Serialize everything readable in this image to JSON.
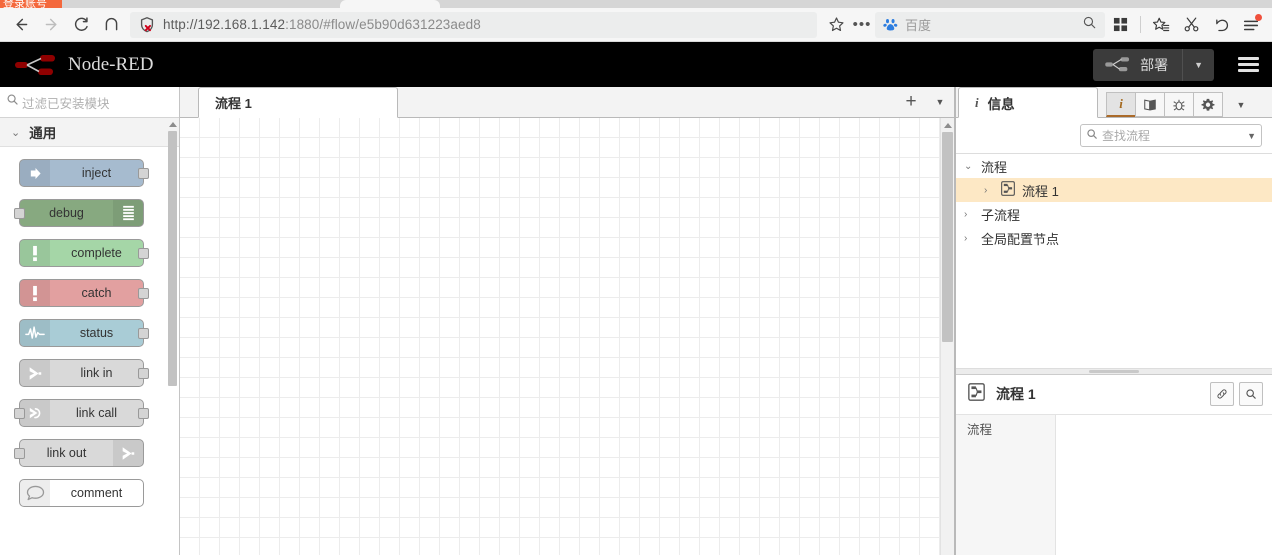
{
  "browser": {
    "tab_fragment_label": "登录账号",
    "nav": {
      "back": "back-arrow",
      "forward": "forward-arrow",
      "reload": "reload",
      "home": "home"
    },
    "url": {
      "host": "http://192.168.1.142",
      "rest": ":1880/#flow/e5b90d631223aed8",
      "security_icon": "shield-x"
    },
    "search": {
      "engine": "百度",
      "placeholder": "百度"
    },
    "toolbar_icons": [
      "bookmark-star",
      "more-dots",
      "grid-apps",
      "collections-star",
      "scissors",
      "undo",
      "menu"
    ]
  },
  "nodered": {
    "title": "Node-RED",
    "deploy_label": "部署",
    "menu_icon": "hamburger-menu"
  },
  "palette": {
    "search_placeholder": "过滤已安装模块",
    "category": "通用",
    "nodes": [
      {
        "label": "inject",
        "color": "#a6bbcf",
        "icon_side": "left",
        "icon": "arrow-right",
        "has_out": true,
        "has_in": false
      },
      {
        "label": "debug",
        "color": "#87a980",
        "icon_side": "right",
        "icon": "debug-lines",
        "has_out": false,
        "has_in": true
      },
      {
        "label": "complete",
        "color": "#a5d6a7",
        "icon_side": "left",
        "icon": "exclamation",
        "has_out": true,
        "has_in": false
      },
      {
        "label": "catch",
        "color": "#e2a0a0",
        "icon_side": "left",
        "icon": "exclamation",
        "has_out": true,
        "has_in": false
      },
      {
        "label": "status",
        "color": "#a9ccd6",
        "icon_side": "left",
        "icon": "pulse",
        "has_out": true,
        "has_in": false
      },
      {
        "label": "link in",
        "color": "#d9d9d9",
        "icon_side": "left",
        "icon": "link-arrow",
        "has_out": true,
        "has_in": false
      },
      {
        "label": "link call",
        "color": "#d9d9d9",
        "icon_side": "left",
        "icon": "link-loop",
        "has_out": true,
        "has_in": true
      },
      {
        "label": "link out",
        "color": "#d9d9d9",
        "icon_side": "right",
        "icon": "link-arrow",
        "has_out": false,
        "has_in": true
      },
      {
        "label": "comment",
        "color": "#ffffff",
        "icon_side": "left",
        "icon": "speech-bubble",
        "has_out": false,
        "has_in": false
      }
    ]
  },
  "workspace": {
    "tab_label": "流程 1",
    "add_tab_icon": "plus-icon",
    "tab_menu_icon": "chevron-down-icon"
  },
  "sidebar": {
    "tab_label": "信息",
    "tools": [
      {
        "name": "info-icon",
        "active": true
      },
      {
        "name": "help-book-icon",
        "active": false
      },
      {
        "name": "debug-bug-icon",
        "active": false
      },
      {
        "name": "config-gear-icon",
        "active": false
      }
    ],
    "caret_icon": "chevron-down-icon",
    "search_placeholder": "查找流程",
    "tree": [
      {
        "label": "流程",
        "level": 0,
        "expanded": true,
        "selected": false,
        "icon": null
      },
      {
        "label": "流程 1",
        "level": 1,
        "expanded": false,
        "selected": true,
        "icon": "flow-icon"
      },
      {
        "label": "子流程",
        "level": 0,
        "expanded": false,
        "selected": false,
        "icon": null
      },
      {
        "label": "全局配置节点",
        "level": 0,
        "expanded": false,
        "selected": false,
        "icon": null
      }
    ],
    "info_panel": {
      "title": "流程 1",
      "icon": "flow-icon",
      "buttons": [
        "link-icon",
        "search-icon"
      ],
      "property_label": "流程"
    }
  },
  "colors": {
    "brand_red": "#8f0000",
    "header_bg": "#000000",
    "select_highlight": "#fde8c5",
    "tab_fragment": "#f4683c"
  }
}
